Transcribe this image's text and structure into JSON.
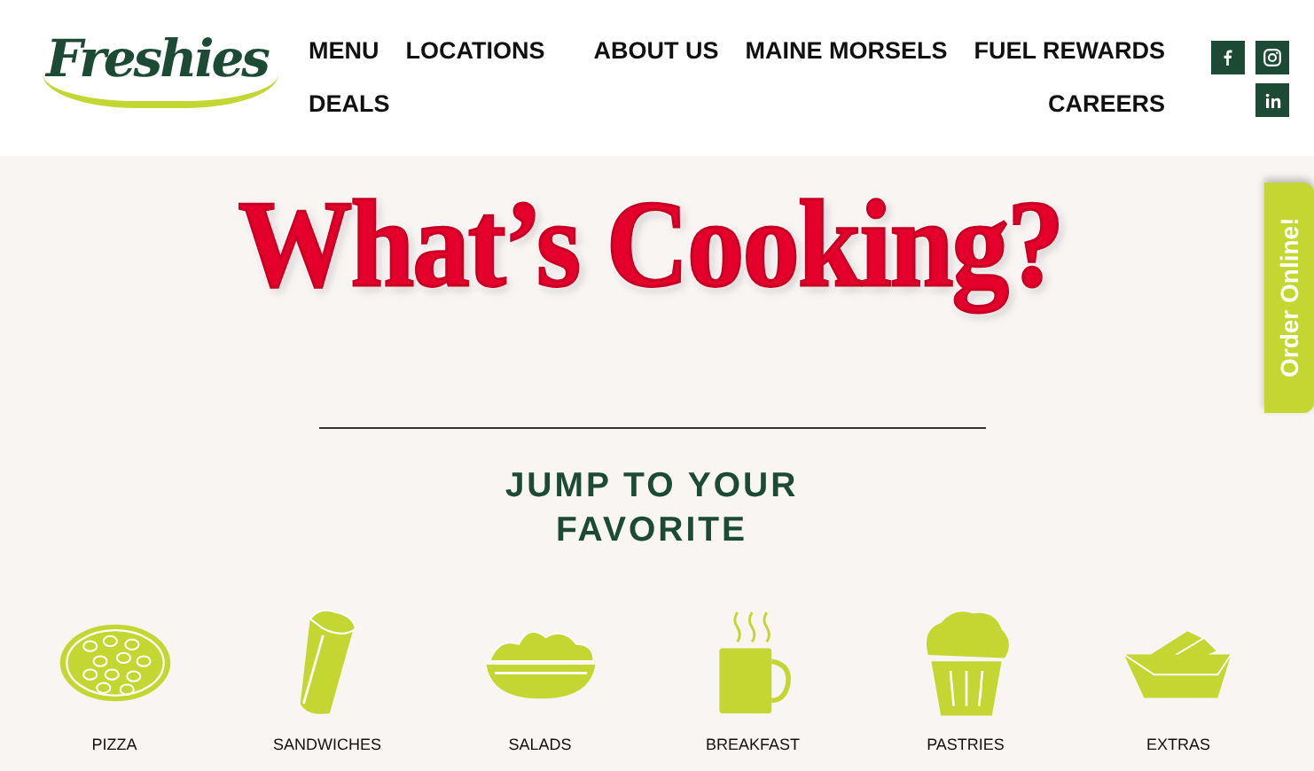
{
  "header": {
    "logo": "Freshies",
    "nav_rows": [
      {
        "left": [
          "MENU",
          "LOCATIONS"
        ],
        "right": [
          "ABOUT US",
          "MAINE MORSELS",
          "FUEL REWARDS"
        ]
      },
      {
        "left": [
          "DEALS"
        ],
        "right": [
          "CAREERS"
        ]
      }
    ],
    "social": [
      {
        "kind": "facebook"
      },
      {
        "kind": "instagram"
      },
      {
        "kind": "linkedin"
      }
    ]
  },
  "hero": {
    "title": "What’s Cooking?"
  },
  "section": {
    "heading": "JUMP TO YOUR FAVORITE",
    "categories": [
      {
        "kind": "pizza",
        "label": "PIZZA"
      },
      {
        "kind": "sandwich",
        "label": "SANDWICHES"
      },
      {
        "kind": "salad",
        "label": "SALADS"
      },
      {
        "kind": "mug",
        "label": "BREAKFAST"
      },
      {
        "kind": "muffin",
        "label": "PASTRIES"
      },
      {
        "kind": "box",
        "label": "EXTRAS"
      }
    ]
  },
  "order_tab": {
    "label": "Order Online!"
  }
}
